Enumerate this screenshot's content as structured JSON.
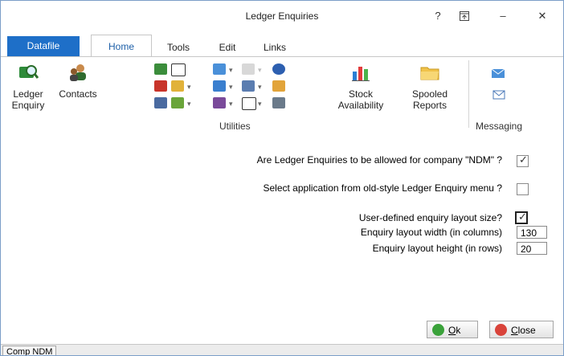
{
  "window": {
    "title": "Ledger Enquiries",
    "help_glyph": "?",
    "ribbon_toggle_glyph": "⊤",
    "minimize_glyph": "–",
    "close_glyph": "✕"
  },
  "tabs": [
    {
      "label": "Datafile"
    },
    {
      "label": "Home"
    },
    {
      "label": "Tools"
    },
    {
      "label": "Edit"
    },
    {
      "label": "Links"
    }
  ],
  "ribbon": {
    "ledger_enquiry": {
      "line1": "Ledger",
      "line2": "Enquiry",
      "icon": "ledger-enquiry-icon"
    },
    "contacts": {
      "label": "Contacts",
      "icon": "contacts-icon"
    },
    "stock_availability": {
      "line1": "Stock",
      "line2": "Availability",
      "icon": "stock-availability-icon"
    },
    "spooled_reports": {
      "line1": "Spooled",
      "line2": "Reports",
      "icon": "folder-icon"
    },
    "utilities_label": "Utilities",
    "messaging_label": "Messaging",
    "colors": {
      "accent": "#1e6fc8",
      "tab_active_text": "#1d5fa8"
    }
  },
  "form": {
    "allow_label": "Are Ledger Enquiries to be allowed for company \"NDM\" ?",
    "allow_checked": true,
    "select_app_label": "Select application from old-style Ledger Enquiry menu ?",
    "select_app_checked": false,
    "user_defined_label": "User-defined enquiry layout size?",
    "user_defined_checked": true,
    "width_label": "Enquiry layout width (in columns)",
    "width_value": "130",
    "height_label": "Enquiry layout height (in rows)",
    "height_value": "20"
  },
  "buttons": {
    "ok_mnemonic": "O",
    "ok_rest": "k",
    "close_mnemonic": "C",
    "close_rest": "lose"
  },
  "status": {
    "company": "Comp NDM"
  }
}
